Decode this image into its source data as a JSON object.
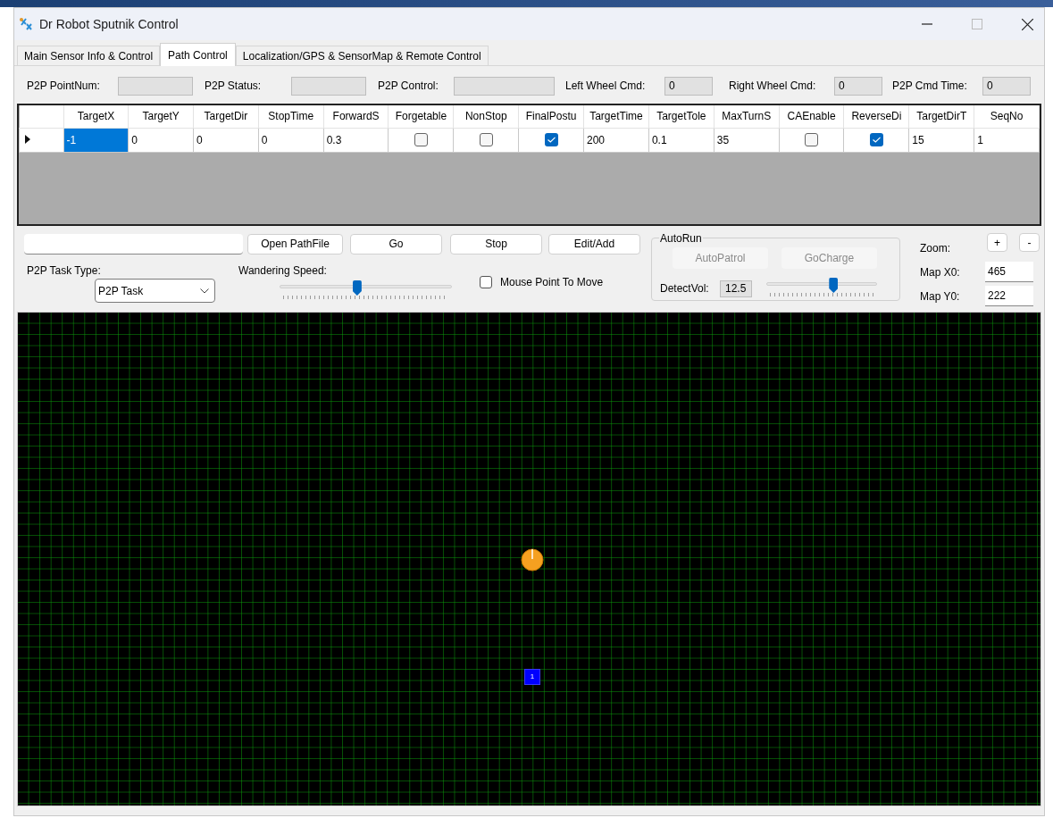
{
  "window": {
    "title": "Dr Robot Sputnik Control"
  },
  "tabs": [
    {
      "label": "Main Sensor Info & Control",
      "selected": false
    },
    {
      "label": "Path Control",
      "selected": true
    },
    {
      "label": "Localization/GPS & SensorMap & Remote Control",
      "selected": false
    }
  ],
  "status_fields": [
    {
      "label": "P2P PointNum:"
    },
    {
      "label": "P2P Status:"
    },
    {
      "label": "P2P Control:"
    },
    {
      "label": "Left Wheel Cmd:",
      "value": "0"
    },
    {
      "label": "Right Wheel Cmd:",
      "value": "0"
    },
    {
      "label": "P2P Cmd Time:",
      "value": "0"
    }
  ],
  "table": {
    "columns": [
      "TargetX",
      "TargetY",
      "TargetDir",
      "StopTime",
      "ForwardS",
      "Forgetable",
      "NonStop",
      "FinalPostu",
      "TargetTime",
      "TargetTole",
      "MaxTurnS",
      "CAEnable",
      "ReverseDi",
      "TargetDirT",
      "SeqNo"
    ],
    "rows": [
      {
        "current": true,
        "cells": [
          {
            "kind": "text",
            "value": "-1",
            "selected": true
          },
          {
            "kind": "text",
            "value": "0",
            "selected": false
          },
          {
            "kind": "text",
            "value": "0",
            "selected": false
          },
          {
            "kind": "text",
            "value": "0",
            "selected": false
          },
          {
            "kind": "text",
            "value": "0.3",
            "selected": false
          },
          {
            "kind": "check",
            "checked": false
          },
          {
            "kind": "check",
            "checked": false
          },
          {
            "kind": "check",
            "checked": true
          },
          {
            "kind": "text",
            "value": "200",
            "selected": false
          },
          {
            "kind": "text",
            "value": "0.1",
            "selected": false
          },
          {
            "kind": "text",
            "value": "35",
            "selected": false
          },
          {
            "kind": "check",
            "checked": false
          },
          {
            "kind": "check",
            "checked": true
          },
          {
            "kind": "text",
            "value": "15",
            "selected": false
          },
          {
            "kind": "text",
            "value": "1",
            "selected": false
          }
        ]
      }
    ]
  },
  "path_buttons": [
    "Open PathFile",
    "Go",
    "Stop",
    "Edit/Add"
  ],
  "task_type": {
    "label": "P2P Task Type:",
    "value": "P2P Task"
  },
  "wandering_speed": {
    "label": "Wandering Speed:",
    "level": 0.45
  },
  "mouse_point": {
    "label": "Mouse Point To Move",
    "checked": false
  },
  "autorun": {
    "title": "AutoRun",
    "buttons": [
      {
        "label": "AutoPatrol",
        "disabled": true
      },
      {
        "label": "GoCharge",
        "disabled": true
      }
    ],
    "detect_vol": {
      "label": "DetectVol:",
      "value": "12.5",
      "level": 0.61
    }
  },
  "zoom": {
    "label": "Zoom:",
    "buttons": [
      "+",
      "-"
    ]
  },
  "map_origin": [
    {
      "label": "Map X0:",
      "value": "465"
    },
    {
      "label": "Map Y0:",
      "value": "222"
    }
  ],
  "map": {
    "waypoints": [
      {
        "label": "1"
      }
    ]
  }
}
